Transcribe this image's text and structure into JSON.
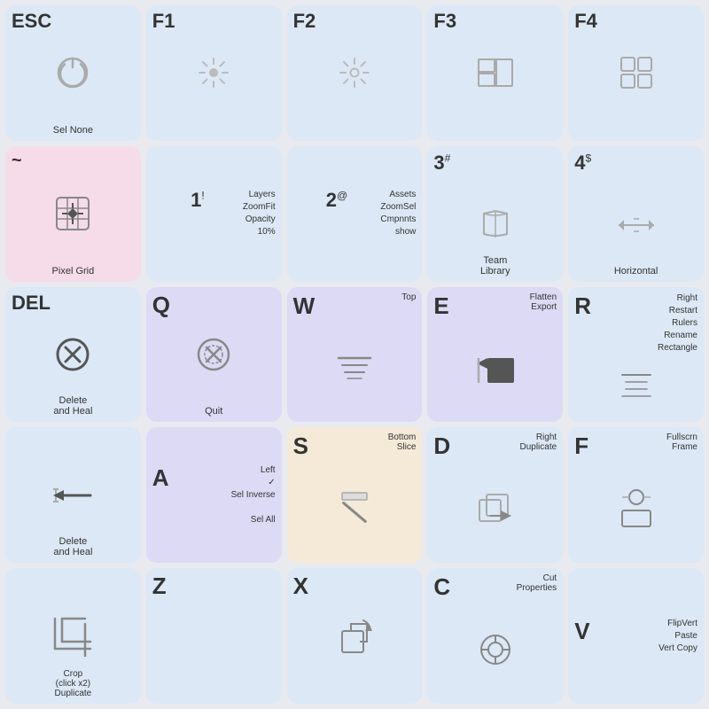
{
  "keys": [
    {
      "id": "esc",
      "label": "ESC",
      "sublabel": "",
      "desc": "Sel None",
      "icon": "power",
      "bg": "bg-blue-light",
      "row": 1
    },
    {
      "id": "f1",
      "label": "F1",
      "sublabel": "",
      "desc": "",
      "icon": "sun",
      "bg": "bg-blue-light",
      "row": 1
    },
    {
      "id": "f2",
      "label": "F2",
      "sublabel": "",
      "desc": "",
      "icon": "sun-dim",
      "bg": "bg-blue-light",
      "row": 1
    },
    {
      "id": "f3",
      "label": "F3",
      "sublabel": "",
      "desc": "",
      "icon": "layout",
      "bg": "bg-blue-light",
      "row": 1
    },
    {
      "id": "f4",
      "label": "F4",
      "sublabel": "",
      "desc": "",
      "icon": "grid",
      "bg": "bg-blue-light",
      "row": 1
    },
    {
      "id": "tilde",
      "label": "~",
      "sublabel": "",
      "desc": "Pixel Grid",
      "icon": "move-grid",
      "bg": "bg-pink",
      "row": 2
    },
    {
      "id": "one",
      "label": "1",
      "sup": "!",
      "sublabel": "Layers\nZoomFit\nOpacity\n10%",
      "desc": "",
      "icon": "",
      "bg": "bg-blue-light",
      "row": 2
    },
    {
      "id": "two",
      "label": "2",
      "sup": "@",
      "sublabel": "Assets\nZoomSel\nCmpnnts\nshow",
      "desc": "",
      "icon": "",
      "bg": "bg-blue-light",
      "row": 2
    },
    {
      "id": "three",
      "label": "3",
      "sup": "#",
      "sublabel": "Team\nLibrary",
      "desc": "",
      "icon": "book",
      "bg": "bg-blue-light",
      "row": 2
    },
    {
      "id": "four",
      "label": "4",
      "sup": "$",
      "sublabel": "Horizontal",
      "desc": "",
      "icon": "arrows-h",
      "bg": "bg-blue-light",
      "row": 2
    },
    {
      "id": "del",
      "label": "DEL",
      "sublabel": "Delete\nand Heal",
      "desc": "",
      "icon": "x-circle",
      "bg": "bg-blue-light",
      "row": 3
    },
    {
      "id": "q",
      "label": "Q",
      "sublabel": "Quit",
      "desc": "",
      "icon": "power-off",
      "bg": "bg-purple-light",
      "row": 3
    },
    {
      "id": "w",
      "label": "W",
      "sublabel": "Top",
      "desc": "",
      "icon": "lines",
      "bg": "bg-purple-light",
      "row": 3
    },
    {
      "id": "e",
      "label": "E",
      "sublabel": "Flatten\nExport",
      "desc": "",
      "icon": "import-box",
      "bg": "bg-purple-light",
      "row": 3
    },
    {
      "id": "r",
      "label": "R",
      "sublabel": "Right\nRestart\nRulers\nRename\nRectangle",
      "desc": "",
      "icon": "rulers",
      "bg": "bg-blue-light",
      "row": 3
    },
    {
      "id": "del2",
      "label": "",
      "sublabel": "Delete\nand Heal",
      "desc": "",
      "icon": "delete-heal",
      "bg": "bg-blue-light",
      "row": 4
    },
    {
      "id": "a",
      "label": "A",
      "sublabel": "Left\nSel Inverse\nSel All",
      "desc": "",
      "icon": "check",
      "bg": "bg-purple-light",
      "row": 4
    },
    {
      "id": "s",
      "label": "S",
      "sublabel": "Bottom\nSlice",
      "desc": "",
      "icon": "slice",
      "bg": "bg-peach",
      "row": 4
    },
    {
      "id": "d",
      "label": "D",
      "sublabel": "Right\nDuplicate",
      "desc": "",
      "icon": "duplicate",
      "bg": "bg-blue-light",
      "row": 4
    },
    {
      "id": "f",
      "label": "F",
      "sublabel": "Fullscrn\nFrame",
      "desc": "",
      "icon": "frame",
      "bg": "bg-blue-light",
      "row": 4
    },
    {
      "id": "crop",
      "label": "",
      "sublabel": "Crop\n(click x2)\nDuplicate",
      "desc": "",
      "icon": "crop",
      "bg": "bg-blue-light",
      "row": 5
    },
    {
      "id": "z",
      "label": "Z",
      "sublabel": "",
      "desc": "",
      "icon": "",
      "bg": "bg-blue-light",
      "row": 5
    },
    {
      "id": "x",
      "label": "X",
      "sublabel": "",
      "desc": "",
      "icon": "transform",
      "bg": "bg-blue-light",
      "row": 5
    },
    {
      "id": "c",
      "label": "C",
      "sublabel": "Cut\nProperties",
      "desc": "",
      "icon": "gear",
      "bg": "bg-blue-light",
      "row": 5
    },
    {
      "id": "v",
      "label": "V",
      "sublabel": "FlipVert\nPaste\nVert Copy",
      "desc": "",
      "icon": "",
      "bg": "bg-blue-light",
      "row": 5
    }
  ]
}
